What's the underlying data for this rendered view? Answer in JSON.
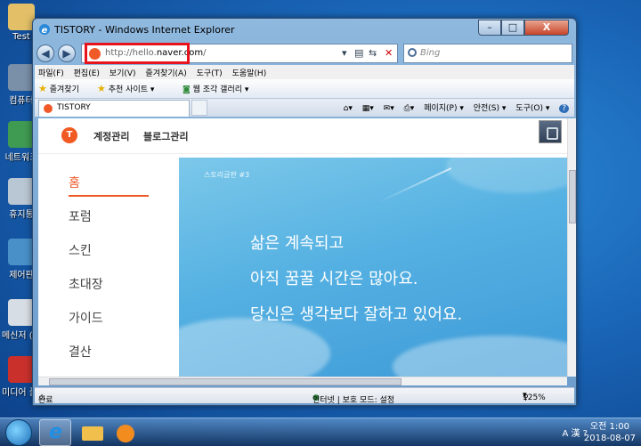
{
  "desktop": {
    "icons": [
      {
        "label": "Test"
      },
      {
        "label": "컴퓨터"
      },
      {
        "label": "네트워크"
      },
      {
        "label": "휴지통"
      },
      {
        "label": "제어판"
      },
      {
        "label": "메신저 (…"
      },
      {
        "label": "미디어 플레이어"
      }
    ]
  },
  "window": {
    "title": "TISTORY - Windows Internet Explorer",
    "controls": {
      "minimize": "–",
      "maximize": "□",
      "close": "X"
    }
  },
  "navbar": {
    "back": "◀",
    "forward": "▶",
    "address_prefix": "http://hello.",
    "address_host": "naver.com",
    "address_suffix": "/",
    "search_placeholder": "Bing"
  },
  "menubar": {
    "items": [
      "파일(F)",
      "편집(E)",
      "보기(V)",
      "즐겨찾기(A)",
      "도구(T)",
      "도움말(H)"
    ]
  },
  "favorites_bar": {
    "favorites": "즐겨찾기",
    "suggested": "추천 사이트 ▾",
    "gallery": "웹 조각 갤러리 ▾"
  },
  "tabs": {
    "active": "TISTORY"
  },
  "command_bar": {
    "page": "페이지(P) ▾",
    "safety": "안전(S) ▾",
    "tools": "도구(O) ▾",
    "help": "?"
  },
  "site": {
    "logo_letter": "T",
    "account": "계정관리",
    "blog_admin": "블로그관리",
    "nav": [
      "홈",
      "포럼",
      "스킨",
      "초대장",
      "가이드",
      "결산"
    ],
    "banner_tag": "스토리글판 #3",
    "banner_lines": [
      "삶은 계속되고",
      "아직 꿈꿀 시간은 많아요.",
      "당신은 생각보다 잘하고 있어요."
    ]
  },
  "statusbar": {
    "status": "완료",
    "zone": "인터넷 | 보호 모드: 설정",
    "zoom": "125%"
  },
  "taskbar": {
    "tray": "A 漢 ?",
    "time": "오전 1:00",
    "date": "2018-08-07"
  }
}
